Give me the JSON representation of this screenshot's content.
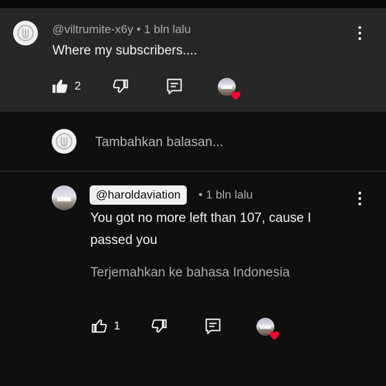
{
  "comments": [
    {
      "author": "@viltrumite-x6y",
      "separator": "•",
      "timestamp": "1 bln lalu",
      "text": "Where my subscribers....",
      "like_count": "2"
    },
    {
      "author": "@haroldaviation",
      "separator": "•",
      "timestamp": "1 bln lalu",
      "text": "You got no more left than 107, cause I passed you",
      "translate": "Terjemahkan ke bahasa Indonesia",
      "like_count": "1"
    }
  ],
  "reply_box": {
    "placeholder": "Tambahkan balasan..."
  },
  "colors": {
    "background": "#0f0f0f",
    "highlight_background": "#272727",
    "text_primary": "#f1f1f1",
    "text_secondary": "#aaaaaa",
    "heart": "#ff0033"
  },
  "icons": [
    "viltrumite-logo-icon",
    "kebab-menu-icon",
    "thumbs-up-icon",
    "thumbs-down-icon",
    "reply-icon",
    "heart-icon"
  ]
}
